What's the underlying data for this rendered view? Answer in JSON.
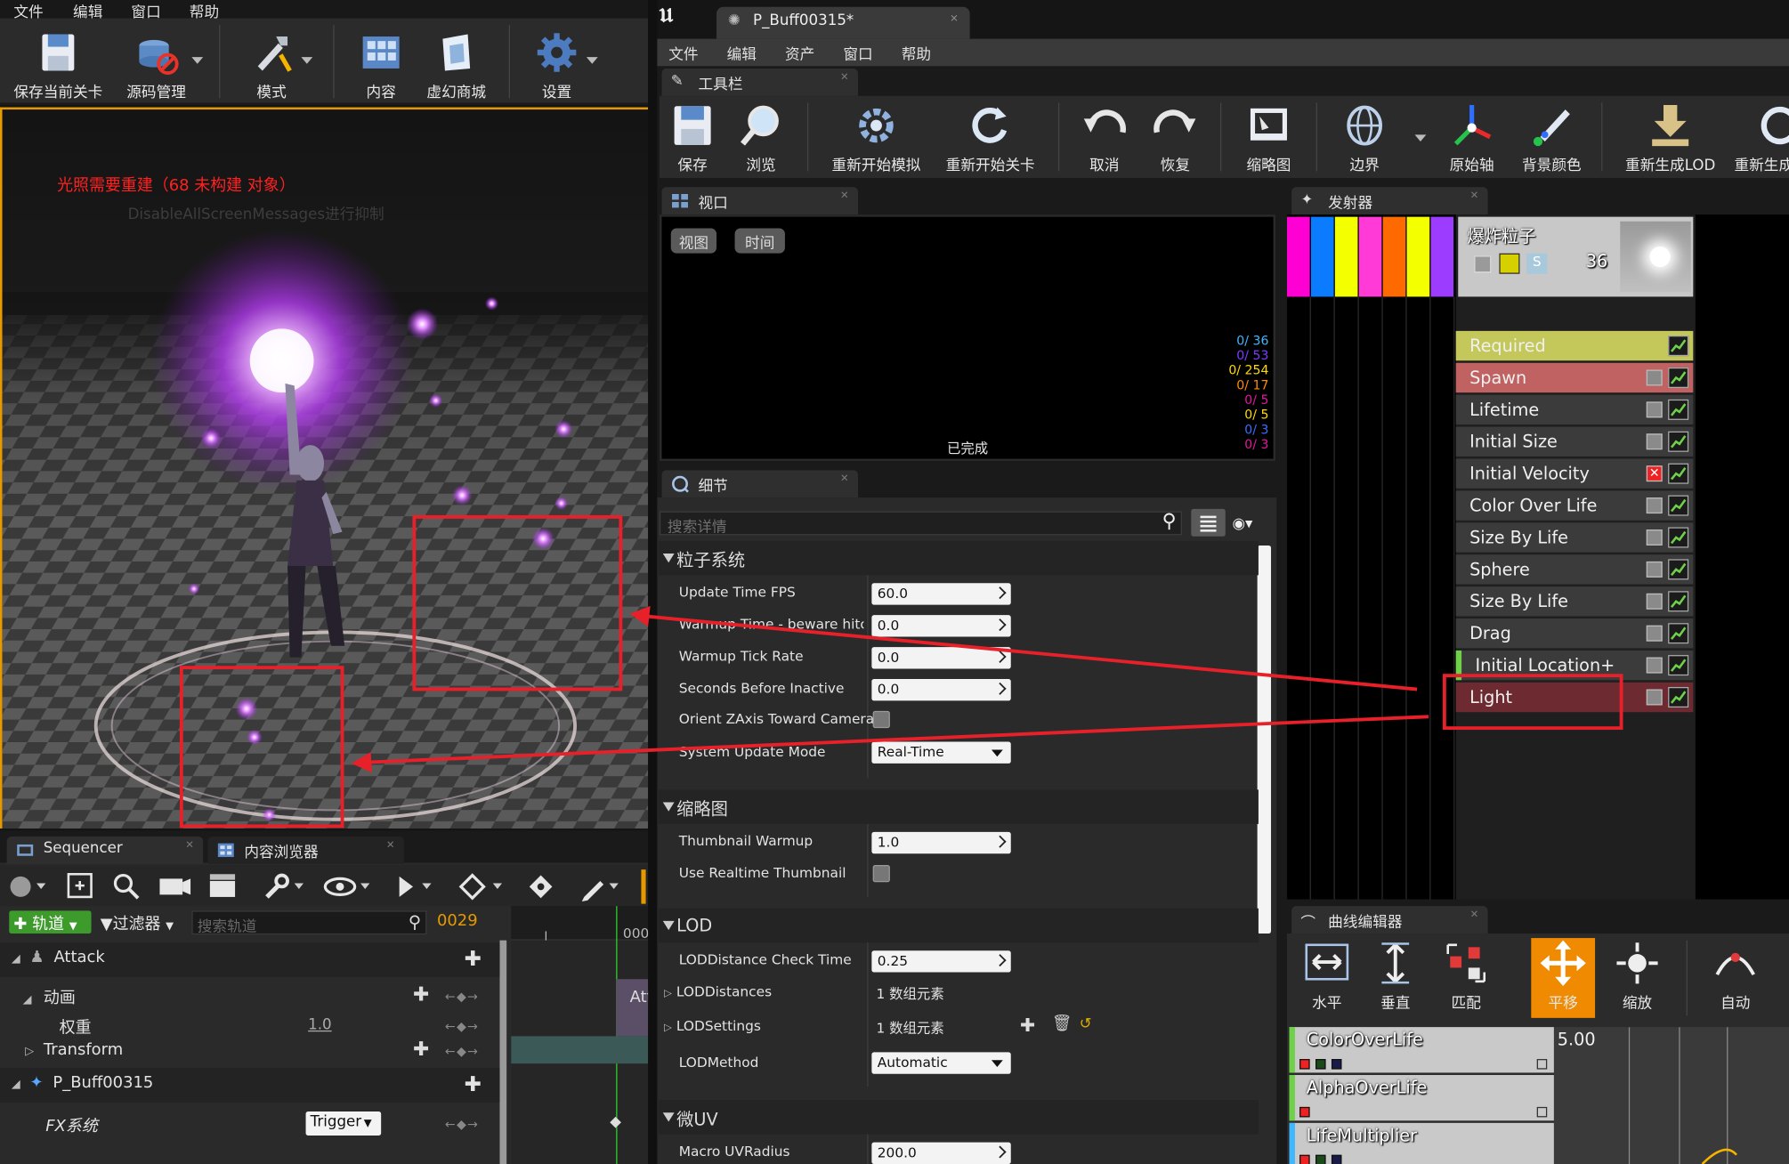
{
  "left_menu": [
    "文件",
    "编辑",
    "窗口",
    "帮助"
  ],
  "left_toolbar": [
    {
      "label": "保存当前关卡",
      "icon": "save-icon"
    },
    {
      "label": "源码管理",
      "icon": "source-control-icon"
    },
    {
      "label": "模式",
      "icon": "modes-icon"
    },
    {
      "label": "内容",
      "icon": "content-icon"
    },
    {
      "label": "虚幻商城",
      "icon": "marketplace-icon"
    },
    {
      "label": "设置",
      "icon": "settings-icon"
    }
  ],
  "level_viewport": {
    "warning": "光照需要重建（68 未构建 对象）",
    "hint": "DisableAllScreenMessages进行抑制"
  },
  "app_tab": {
    "title": "P_Buff00315*"
  },
  "cascade_menu": [
    "文件",
    "编辑",
    "资产",
    "窗口",
    "帮助"
  ],
  "toolbar_tab": "工具栏",
  "cascade_toolbar": [
    {
      "label": "保存",
      "icon": "save-icon"
    },
    {
      "label": "浏览",
      "icon": "browse-icon"
    },
    {
      "label": "重新开始模拟",
      "icon": "restart-sim-icon"
    },
    {
      "label": "重新开始关卡",
      "icon": "restart-level-icon"
    },
    {
      "label": "取消",
      "icon": "undo-icon"
    },
    {
      "label": "恢复",
      "icon": "redo-icon"
    },
    {
      "label": "缩略图",
      "icon": "thumbnail-icon"
    },
    {
      "label": "边界",
      "icon": "bounds-icon"
    },
    {
      "label": "原始轴",
      "icon": "origin-axis-icon"
    },
    {
      "label": "背景颜色",
      "icon": "bg-color-icon"
    },
    {
      "label": "重新生成LOD",
      "icon": "regen-lod-icon"
    },
    {
      "label": "重新生成",
      "icon": "regen-icon"
    }
  ],
  "viewport_panel": {
    "tab": "视口",
    "btn_view": "视图",
    "btn_time": "时间",
    "status": "已完成",
    "stats": [
      {
        "text": "0/ 36",
        "color": "#3fb7ff"
      },
      {
        "text": "0/ 53",
        "color": "#7a3cff"
      },
      {
        "text": "0/ 254",
        "color": "#ffd900"
      },
      {
        "text": "0/ 17",
        "color": "#ff8a00"
      },
      {
        "text": "0/ 5",
        "color": "#e0179a"
      },
      {
        "text": "0/ 5",
        "color": "#ffd900"
      },
      {
        "text": "0/ 3",
        "color": "#3c6cff"
      },
      {
        "text": "0/ 3",
        "color": "#e0179a"
      }
    ]
  },
  "details": {
    "tab": "细节",
    "search_placeholder": "搜索详情",
    "sec_particle": "粒子系统",
    "update_fps_label": "Update Time FPS",
    "update_fps": "60.0",
    "warmup_time_label": "Warmup Time - beware hitches!",
    "warmup_time": "0.0",
    "warmup_tick_label": "Warmup Tick Rate",
    "warmup_tick": "0.0",
    "seconds_inactive_label": "Seconds Before Inactive",
    "seconds_inactive": "0.0",
    "orient_label": "Orient ZAxis Toward Camera",
    "update_mode_label": "System Update Mode",
    "update_mode": "Real-Time",
    "sec_thumb": "缩略图",
    "thumb_warmup_label": "Thumbnail Warmup",
    "thumb_warmup": "1.0",
    "realtime_thumb_label": "Use Realtime Thumbnail",
    "sec_lod": "LOD",
    "lod_dist_check_label": "LODDistance Check Time",
    "lod_dist_check": "0.25",
    "lod_distances_label": "LODDistances",
    "lod_distances": "1 数组元素",
    "lod_settings_label": "LODSettings",
    "lod_settings": "1 数组元素",
    "lod_method_label": "LODMethod",
    "lod_method": "Automatic",
    "sec_uv": "微UV",
    "macro_uv_label": "Macro UVRadius",
    "macro_uv": "200.0"
  },
  "emitters": {
    "tab": "发射器",
    "emitter_name": "爆炸粒子",
    "count": "36",
    "color_strips": [
      "#ff00d4",
      "#0b7bff",
      "#f4ff00",
      "#ff3ad7",
      "#ff6a00",
      "#f4ff00",
      "#9c3cff"
    ],
    "modules": [
      {
        "name": "Required",
        "bg": "#c4c85a"
      },
      {
        "name": "Spawn",
        "bg": "#c06262"
      },
      {
        "name": "Lifetime",
        "bg": "#3b3b3b"
      },
      {
        "name": "Initial Size",
        "bg": "#3b3b3b"
      },
      {
        "name": "Initial Velocity",
        "bg": "#3b3b3b"
      },
      {
        "name": "Color Over Life",
        "bg": "#3b3b3b"
      },
      {
        "name": "Size By Life",
        "bg": "#3b3b3b"
      },
      {
        "name": "Sphere",
        "bg": "#3b3b3b"
      },
      {
        "name": "Size By Life",
        "bg": "#3b3b3b"
      },
      {
        "name": "Drag",
        "bg": "#3b3b3b"
      },
      {
        "name": "Initial Location+",
        "bg": "#3b3b3b"
      },
      {
        "name": "Light",
        "bg": "#6d2b31"
      }
    ]
  },
  "curve_editor": {
    "tab": "曲线编辑器",
    "tools": [
      {
        "label": "水平",
        "icon": "fit-horizontal-icon"
      },
      {
        "label": "垂直",
        "icon": "fit-vertical-icon"
      },
      {
        "label": "匹配",
        "icon": "fit-icon"
      },
      {
        "label": "平移",
        "icon": "pan-icon"
      },
      {
        "label": "缩放",
        "icon": "zoom-icon"
      },
      {
        "label": "自动",
        "icon": "auto-icon"
      }
    ],
    "curves": [
      "ColorOverLife",
      "AlphaOverLife",
      "LifeMultiplier"
    ],
    "axis_value": "5.00"
  },
  "sequencer": {
    "tab": "Sequencer",
    "tab2": "内容浏览器",
    "add_track": "轨道",
    "filter": "过滤器",
    "search_placeholder": "搜索轨道",
    "frame": "0029",
    "time_label": "000",
    "rows": {
      "attack": "Attack",
      "anim": "动画",
      "weight_label": "权重",
      "weight": "1.0",
      "transform": "Transform",
      "buff": "P_Buff00315",
      "fx": "FX系统",
      "trigger": "Trigger",
      "clip": "Att"
    }
  },
  "colors": {
    "accent_orange": "#f08a00",
    "annotation_red": "#e8202a",
    "selection_green": "#6fd04a"
  }
}
